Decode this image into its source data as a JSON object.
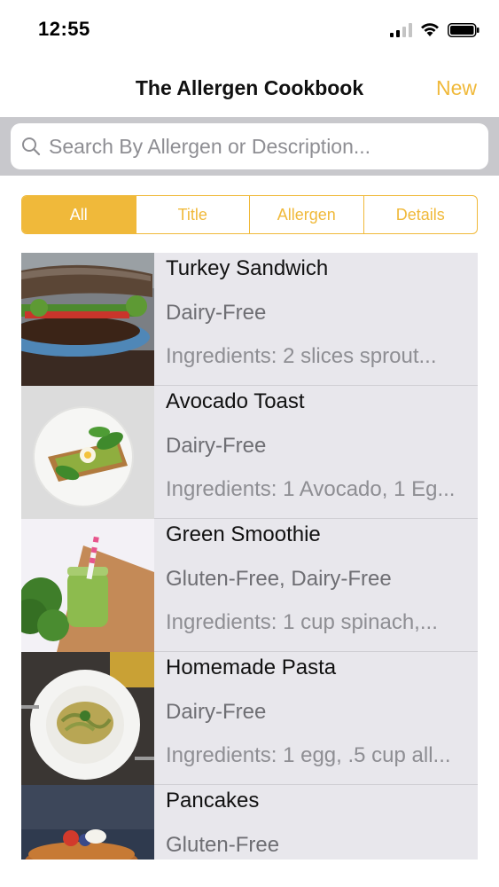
{
  "status_bar": {
    "time": "12:55"
  },
  "nav": {
    "title": "The Allergen Cookbook",
    "new_label": "New"
  },
  "search": {
    "placeholder": "Search By Allergen or Description..."
  },
  "segments": [
    {
      "label": "All",
      "selected": true
    },
    {
      "label": "Title",
      "selected": false
    },
    {
      "label": "Allergen",
      "selected": false
    },
    {
      "label": "Details",
      "selected": false
    }
  ],
  "recipes": [
    {
      "title": "Turkey Sandwich",
      "allergen": "Dairy-Free",
      "ingredients": "Ingredients: 2 slices sprout..."
    },
    {
      "title": "Avocado Toast",
      "allergen": "Dairy-Free",
      "ingredients": "Ingredients: 1 Avocado, 1 Eg..."
    },
    {
      "title": "Green Smoothie",
      "allergen": "Gluten-Free, Dairy-Free",
      "ingredients": "Ingredients: 1 cup spinach,..."
    },
    {
      "title": "Homemade Pasta",
      "allergen": "Dairy-Free",
      "ingredients": "Ingredients: 1 egg, .5 cup all..."
    },
    {
      "title": "Pancakes",
      "allergen": "Gluten-Free",
      "ingredients": ""
    }
  ],
  "colors": {
    "accent": "#f0b93a",
    "list_bg": "#e8e7ec",
    "search_bar_bg": "#c8c8cc"
  },
  "icons": {
    "signal": "cellular-signal-icon",
    "wifi": "wifi-icon",
    "battery": "battery-icon",
    "search": "search-icon"
  }
}
